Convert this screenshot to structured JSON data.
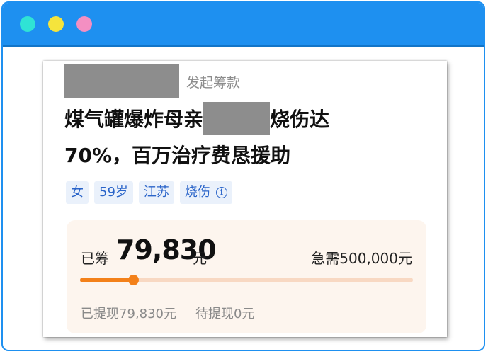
{
  "window": {
    "border_color": "#1e90f0",
    "dots": [
      {
        "name": "teal",
        "color": "#2fe3d5"
      },
      {
        "name": "yellow",
        "color": "#f5e43c"
      },
      {
        "name": "pink",
        "color": "#f48fc2"
      }
    ]
  },
  "card": {
    "initiator_suffix": "发起筹款",
    "title_part1": "煤气罐爆炸母亲",
    "title_part2": "烧伤达",
    "title_line2": "70%，百万治疗费恳援助",
    "tags": [
      "女",
      "59岁",
      "江苏",
      "烧伤"
    ],
    "tag_info_icon": "info-circle-icon",
    "funding": {
      "raised_label": "已筹",
      "raised_amount": "79,830",
      "raised_unit": "元",
      "need_text": "急需500,000元",
      "progress_fraction": 0.16,
      "withdrawn_text": "已提现79,830元",
      "pending_text": "待提现0元",
      "accent_color": "#f38019"
    }
  }
}
